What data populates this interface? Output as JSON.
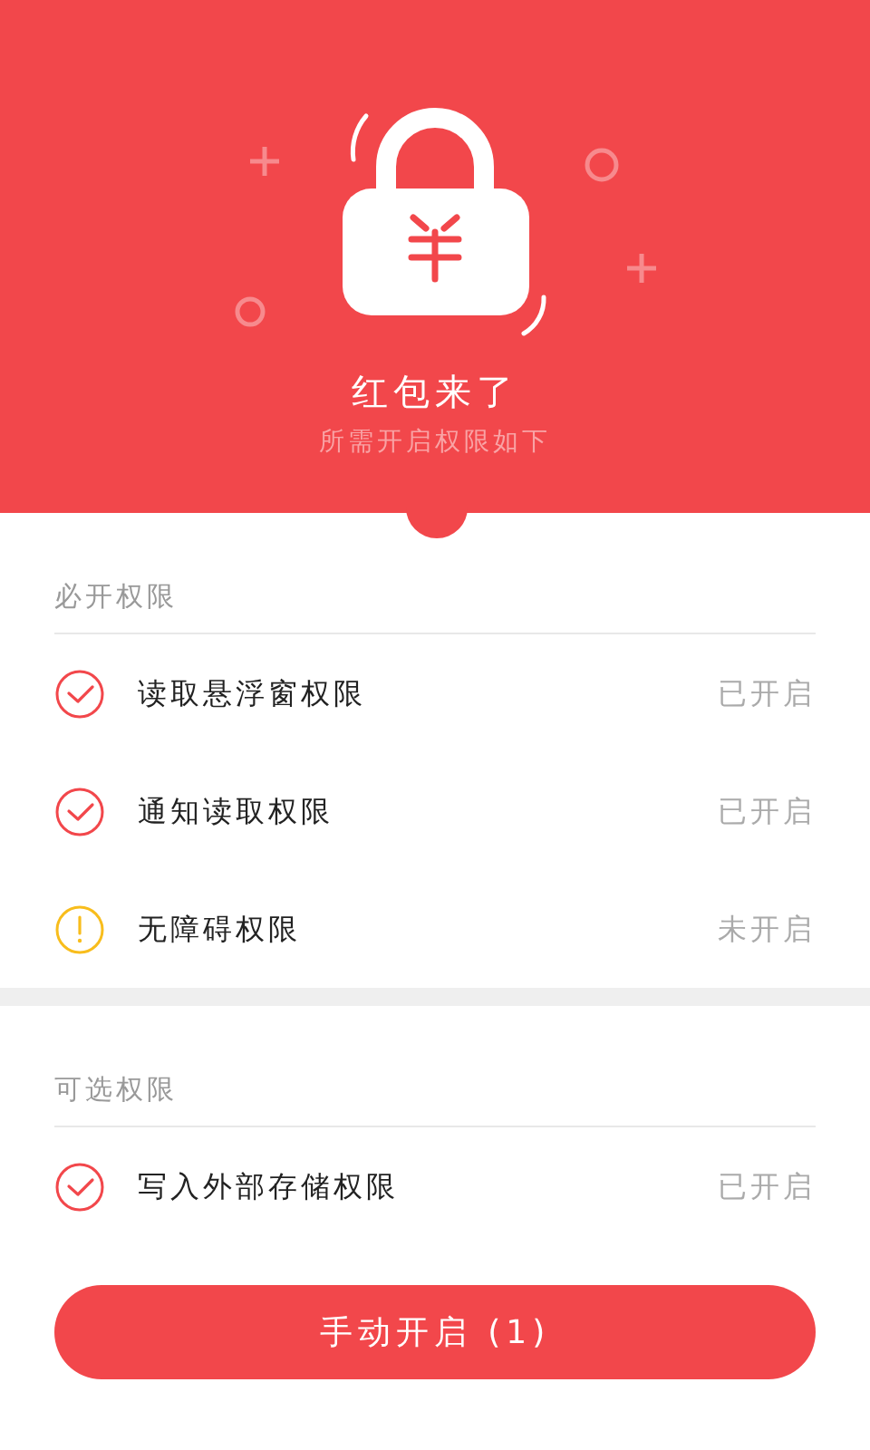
{
  "header": {
    "title": "红包来了",
    "subtitle": "所需开启权限如下"
  },
  "sections": [
    {
      "title": "必开权限",
      "items": [
        {
          "name": "读取悬浮窗权限",
          "enabled": true,
          "status": "已开启"
        },
        {
          "name": "通知读取权限",
          "enabled": true,
          "status": "已开启"
        },
        {
          "name": "无障碍权限",
          "enabled": false,
          "status": "未开启"
        }
      ]
    },
    {
      "title": "可选权限",
      "items": [
        {
          "name": "写入外部存储权限",
          "enabled": true,
          "status": "已开启"
        }
      ]
    }
  ],
  "button": {
    "label": "手动开启 (1)"
  }
}
